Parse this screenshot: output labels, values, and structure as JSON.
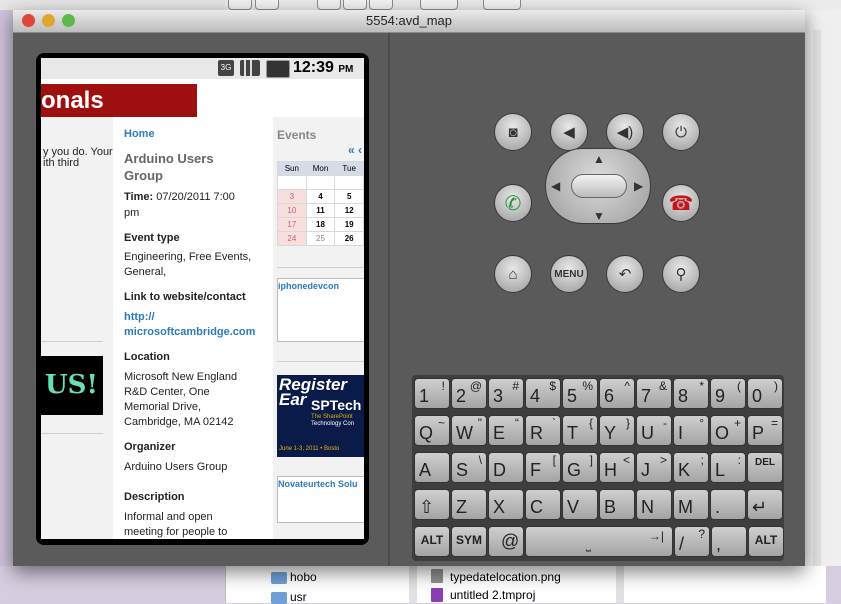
{
  "window": {
    "title": "5554:avd_map"
  },
  "phone": {
    "clock": "12:39",
    "ampm": "PM",
    "network": "3G"
  },
  "page": {
    "banner_text": "onals",
    "left_snippet": [
      "y you do. Your",
      "ith third"
    ],
    "us_logo": "US!",
    "main": {
      "home": "Home",
      "title": [
        "Arduino Users",
        "Group"
      ],
      "time_label": "Time:",
      "time_value": [
        "07/20/2011 7:00",
        "pm"
      ],
      "event_type_heading": "Event type",
      "event_type_value": [
        "Engineering, Free Events,",
        "General,"
      ],
      "link_heading": "Link to website/contact",
      "link_value": [
        "http://",
        "microsoftcambridge.com"
      ],
      "location_heading": "Location",
      "location_value": [
        "Microsoft New England",
        "R&D Center, One",
        "Memorial Drive,",
        "Cambridge, MA 02142"
      ],
      "organizer_heading": "Organizer",
      "organizer_value": "Arduino Users Group",
      "description_heading": "Description",
      "description_value": [
        "Informal and open",
        "meeting for people to"
      ]
    },
    "sidebar": {
      "events_heading": "Events",
      "nav": "« ‹",
      "calendar_headers": [
        "Sun",
        "Mon",
        "Tue"
      ],
      "calendar_rows": [
        [
          "",
          "",
          ""
        ],
        [
          "3",
          "4",
          "5"
        ],
        [
          "10",
          "11",
          "12"
        ],
        [
          "17",
          "18",
          "19"
        ],
        [
          "24",
          "25",
          "26"
        ]
      ],
      "ad1_title": "iphonedevcon",
      "register_text": [
        "Register Ear",
        "SPTech"
      ],
      "register_sub": [
        "The SharePoint",
        "Technology Con"
      ],
      "register_date": "June 1-3, 2011 • Bosto",
      "ad2_title": "Novateurtech Solu"
    }
  },
  "keyboard": {
    "rows": [
      [
        [
          "1",
          "!"
        ],
        [
          "2",
          "@"
        ],
        [
          "3",
          "#"
        ],
        [
          "4",
          "$"
        ],
        [
          "5",
          "%"
        ],
        [
          "6",
          "^"
        ],
        [
          "7",
          "&"
        ],
        [
          "8",
          "*"
        ],
        [
          "9",
          "("
        ],
        [
          "0",
          ")"
        ]
      ],
      [
        [
          "Q",
          "~"
        ],
        [
          "W",
          "\""
        ],
        [
          "E",
          "“"
        ],
        [
          "R",
          "`"
        ],
        [
          "T",
          "{"
        ],
        [
          "Y",
          "}"
        ],
        [
          "U",
          "-"
        ],
        [
          "I",
          "°"
        ],
        [
          "O",
          "+"
        ],
        [
          "P",
          "="
        ]
      ],
      [
        [
          "A",
          ""
        ],
        [
          "S",
          "\\"
        ],
        [
          "D",
          ""
        ],
        [
          "F",
          "["
        ],
        [
          "G",
          "]"
        ],
        [
          "H",
          "<"
        ],
        [
          "J",
          ">"
        ],
        [
          "K",
          ";"
        ],
        [
          "L",
          ":"
        ],
        [
          "DEL",
          ""
        ]
      ],
      [
        [
          "⇧",
          ""
        ],
        [
          "Z",
          ""
        ],
        [
          "X",
          ""
        ],
        [
          "C",
          ""
        ],
        [
          "V",
          ""
        ],
        [
          "B",
          ""
        ],
        [
          "N",
          ""
        ],
        [
          "M",
          ""
        ],
        [
          ".",
          ""
        ],
        [
          "↵",
          ""
        ]
      ]
    ],
    "bottom": {
      "alt_left": "ALT",
      "sym": "SYM",
      "at": "@",
      "slash": "/",
      "question": "?",
      "comma": ",",
      "alt_right": "ALT"
    },
    "menu_label": "MENU"
  },
  "finder": {
    "items": [
      {
        "name": "hobo",
        "type": "folder"
      },
      {
        "name": "usr",
        "type": "folder"
      },
      {
        "name": "typedatelocation.png",
        "type": "file"
      },
      {
        "name": "untitled 2.tmproj",
        "type": "file"
      }
    ]
  },
  "colors": {
    "banner": "#9e1010",
    "link": "#2b7bbd",
    "call_green": "#2e8f3a",
    "end_red": "#c4161c"
  }
}
